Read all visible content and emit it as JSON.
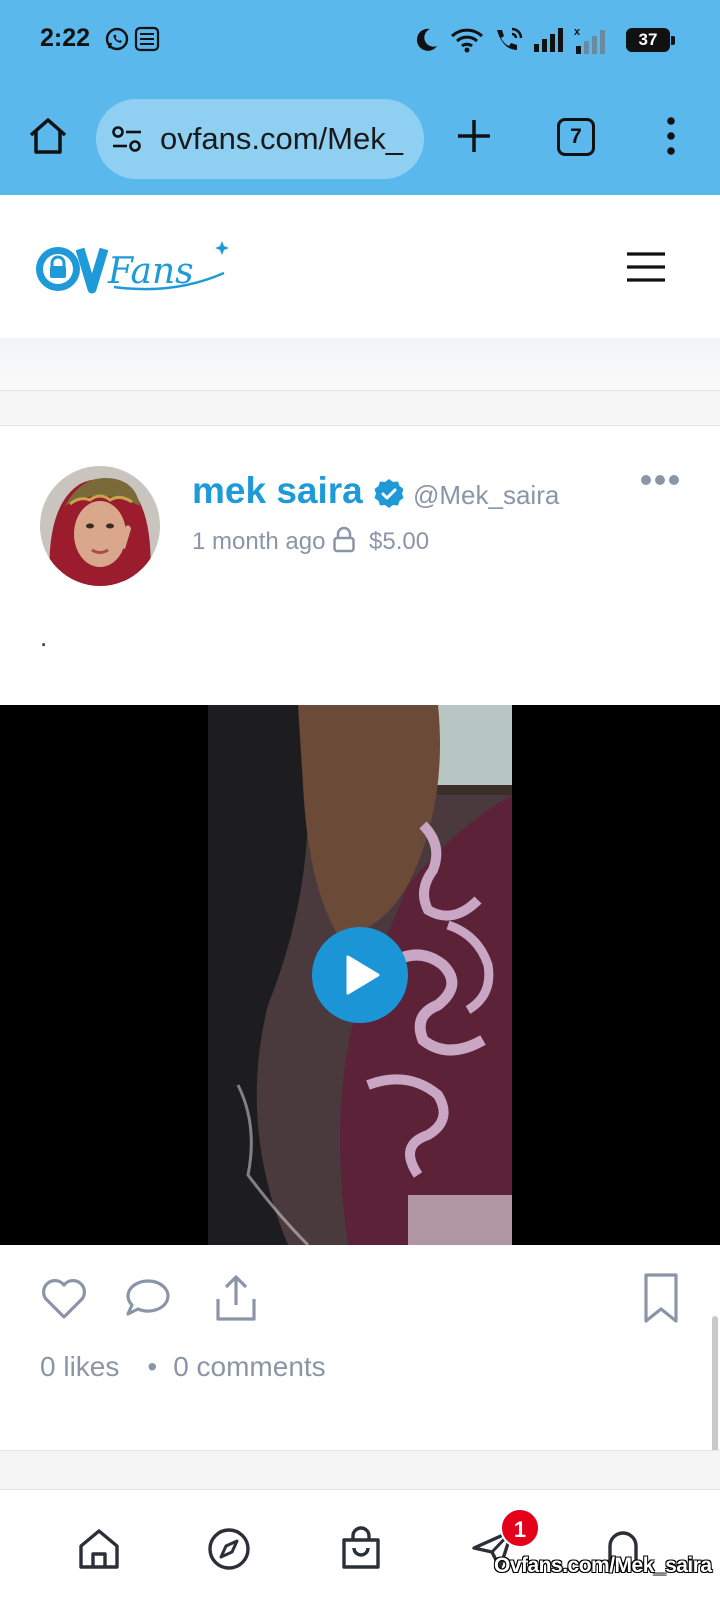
{
  "status_bar": {
    "time": "2:22",
    "battery": "37"
  },
  "browser": {
    "url": "ovfans.com/Mek_",
    "tab_count": "7"
  },
  "site": {
    "logo_text": "OVFans"
  },
  "post": {
    "author_name": "mek saira",
    "author_handle": "@Mek_saira",
    "time_ago": "1 month ago",
    "price": "$5.00",
    "text": ".",
    "likes": "0 likes",
    "separator": "•",
    "comments": "0 comments"
  },
  "bottom_nav": {
    "messages_badge": "1"
  },
  "watermark": "Ovfans.com/Mek_saira",
  "colors": {
    "chrome": "#5ab8ec",
    "accent": "#1f9ad8",
    "muted": "#8a96a8",
    "badge": "#e3001b"
  }
}
